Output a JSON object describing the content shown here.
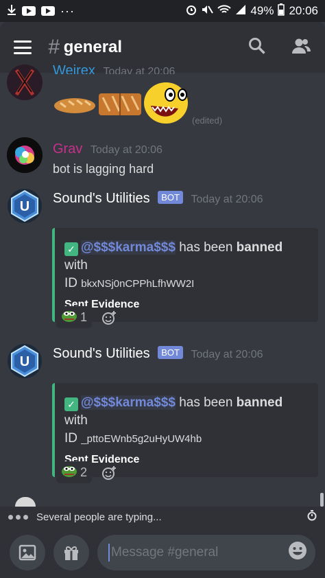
{
  "statusbar": {
    "battery": "49%",
    "time": "20:06",
    "more": "···"
  },
  "header": {
    "hash": "#",
    "channel": "general"
  },
  "messages": [
    {
      "author": "Wejrex",
      "time": "Today at 20:06",
      "edited": "(edited)",
      "color": "#3498db"
    },
    {
      "author": "Grav",
      "time": "Today at 20:06",
      "text": "bot is lagging hard",
      "color": "#c8308c"
    },
    {
      "author": "Sound's Utilities",
      "badge": "BOT",
      "time": "Today at 20:06",
      "embed": {
        "mention": "@$$$karma$$$",
        "text_a": " has been ",
        "bold": "banned",
        "text_b": " with",
        "id_label": "ID ",
        "id": "bkxNSj0nCPPhLfhWW2I",
        "field": "Sent Evidence"
      },
      "reaction_count": "1"
    },
    {
      "author": "Sound's Utilities",
      "badge": "BOT",
      "time": "Today at 20:06",
      "embed": {
        "mention": "@$$$karma$$$",
        "text_a": " has been ",
        "bold": "banned",
        "text_b": " with",
        "id_label": "ID ",
        "id": "_pttoEWnb5g2uHyUW4hb",
        "field": "Sent Evidence"
      },
      "reaction_count": "2"
    }
  ],
  "typing": {
    "text": "Several people are typing..."
  },
  "composer": {
    "placeholder": "Message #general"
  },
  "colors": {
    "background": "#36393f",
    "panel": "#2f3136",
    "blurple": "#7289da",
    "embed_border": "#43b581"
  }
}
